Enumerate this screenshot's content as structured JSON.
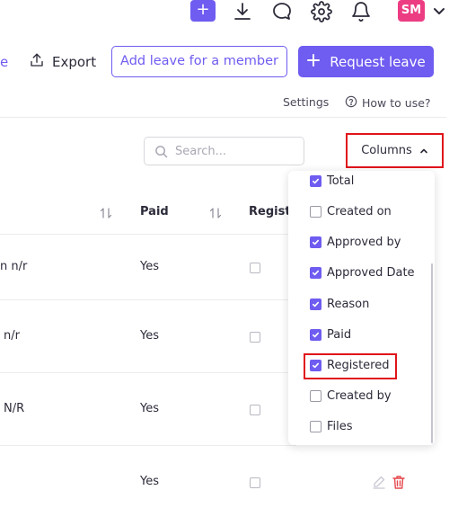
{
  "topbar": {
    "plus_label": "+",
    "avatar_initials": "SM",
    "icons": [
      "download-icon",
      "chat-icon",
      "gear-icon",
      "bell-icon",
      "chevron-down-icon"
    ]
  },
  "actions": {
    "left_fragment": "e",
    "export_label": "Export",
    "add_leave_label": "Add leave for a member",
    "request_leave_label": "Request leave"
  },
  "links": {
    "settings": "Settings",
    "how_to_use": "How to use?"
  },
  "search": {
    "placeholder": "Search..."
  },
  "columns_button": {
    "label": "Columns"
  },
  "table": {
    "headers": {
      "paid": "Paid",
      "registered": "Registe"
    },
    "rows": [
      {
        "name": "n n/r",
        "paid": "Yes",
        "registered": false
      },
      {
        "name": "n/r",
        "paid": "Yes",
        "registered": false
      },
      {
        "name": "N/R",
        "paid": "Yes",
        "registered": false
      },
      {
        "name": "",
        "paid": "Yes",
        "registered": false
      }
    ]
  },
  "dropdown": {
    "items": [
      {
        "label": "Total",
        "checked": true
      },
      {
        "label": "Created on",
        "checked": false
      },
      {
        "label": "Approved by",
        "checked": true
      },
      {
        "label": "Approved Date",
        "checked": true
      },
      {
        "label": "Reason",
        "checked": true
      },
      {
        "label": "Paid",
        "checked": true
      },
      {
        "label": "Registered",
        "checked": true
      },
      {
        "label": "Created by",
        "checked": false
      },
      {
        "label": "Files",
        "checked": false
      }
    ]
  },
  "colors": {
    "accent": "#6f5cf0",
    "avatar": "#ec3d83",
    "highlight": "#e0141b",
    "delete": "#e5484d"
  }
}
